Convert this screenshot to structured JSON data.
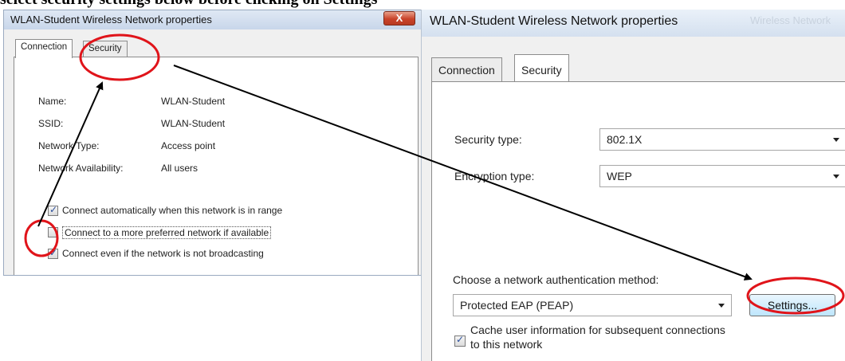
{
  "caption": "select security settings below before clicking on Settings",
  "left_dialog": {
    "title": "WLAN-Student Wireless Network properties",
    "close_glyph": "X",
    "tabs": [
      {
        "label": "Connection"
      },
      {
        "label": "Security"
      }
    ],
    "fields": [
      {
        "label": "Name:",
        "value": "WLAN-Student"
      },
      {
        "label": "SSID:",
        "value": "WLAN-Student"
      },
      {
        "label": "Network Type:",
        "value": "Access point"
      },
      {
        "label": "Network Availability:",
        "value": "All users"
      }
    ],
    "checkboxes": [
      {
        "label": "Connect automatically when this network is in range",
        "checked": true
      },
      {
        "label": "Connect to a more preferred network if available",
        "checked": false
      },
      {
        "label": "Connect even if the network is not broadcasting",
        "checked": true
      }
    ]
  },
  "right_dialog": {
    "title": "WLAN-Student Wireless Network properties",
    "title_ghost": "Wireless Network",
    "tabs": [
      {
        "label": "Connection"
      },
      {
        "label": "Security"
      }
    ],
    "security_type_label": "Security type:",
    "security_type_value": "802.1X",
    "encryption_type_label": "Encryption type:",
    "encryption_type_value": "WEP",
    "auth_method_label": "Choose a network authentication method:",
    "auth_method_value": "Protected EAP (PEAP)",
    "settings_button": "Settings...",
    "cache_checkbox_line1": "Cache user information for subsequent connections",
    "cache_checkbox_line2": "to this network",
    "cache_checked": true
  },
  "colors": {
    "annotation_red": "#e0141a",
    "arrow_black": "#000000"
  }
}
